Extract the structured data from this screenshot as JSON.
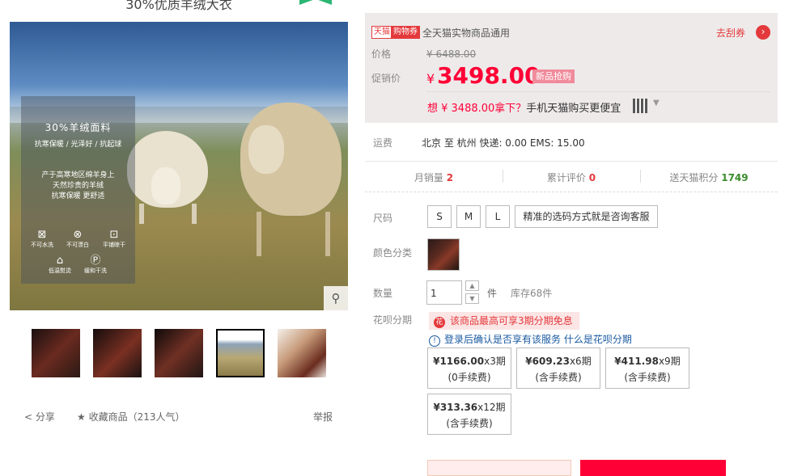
{
  "product": {
    "top_caption": "30%优质羊绒大衣",
    "image_panel": {
      "headline": "30%羊绒面料",
      "features": "抗寒保暖 / 光泽好 / 抗起球",
      "description": "产于高寒地区绵羊身上\n天然珍贵的羊绒\n抗寒保暖 更舒适",
      "care": [
        {
          "icon": "no-wash-icon",
          "glyph": "⊠",
          "label": "不可水洗"
        },
        {
          "icon": "no-bleach-icon",
          "glyph": "⊗",
          "label": "不可漂白"
        },
        {
          "icon": "flat-dry-icon",
          "glyph": "⊡",
          "label": "平铺晾干"
        },
        {
          "icon": "low-iron-icon",
          "glyph": "⌂",
          "label": "低温熨烫"
        },
        {
          "icon": "dry-clean-icon",
          "glyph": "Ⓟ",
          "label": "缓和干洗"
        }
      ]
    },
    "actions": {
      "share": "分享",
      "favorite": "收藏商品",
      "popularity": "（213人气）",
      "report": "举报"
    }
  },
  "coupon": {
    "brand_tag": "天猫",
    "type_tag": "购物券",
    "description": "全天猫实物商品通用",
    "link": "去刮券"
  },
  "price": {
    "original_label": "价格",
    "original": "¥ 6488.00",
    "promo_label": "促销价",
    "currency": "¥",
    "promo": "3498.00",
    "badge": "新品抢购",
    "mobile_prefix": "想 ¥ 3488.00拿下？",
    "mobile_suffix": "手机天猫购买更便宜"
  },
  "shipping": {
    "label": "运费",
    "text": "北京  至  杭州  快递: 0.00  EMS: 15.00"
  },
  "stats": {
    "monthly_label": "月销量",
    "monthly": "2",
    "reviews_label": "累计评价",
    "reviews": "0",
    "points_label": "送天猫积分",
    "points": "1749"
  },
  "options": {
    "size_label": "尺码",
    "sizes": [
      "S",
      "M",
      "L"
    ],
    "size_note": "精准的选码方式就是咨询客服",
    "color_label": "颜色分类",
    "qty_label": "数量",
    "qty_value": "1",
    "unit": "件",
    "stock": "库存68件",
    "installment_label": "花呗分期",
    "installment_banner": "该商品最高可享3期分期免息",
    "installment_notice": "登录后确认是否享有该服务",
    "installment_link": "什么是花呗分期",
    "plans": [
      {
        "amount": "¥1166.00",
        "periods": "x3期",
        "fee": "(0手续费)"
      },
      {
        "amount": "¥609.23",
        "periods": "x6期",
        "fee": "(含手续费)"
      },
      {
        "amount": "¥411.98",
        "periods": "x9期",
        "fee": "(含手续费)"
      },
      {
        "amount": "¥313.36",
        "periods": "x12期",
        "fee": "(含手续费)"
      }
    ]
  },
  "colors": {
    "accent": "#ff0036",
    "tmall_red": "#e4393c",
    "points_green": "#3a8c2c"
  }
}
